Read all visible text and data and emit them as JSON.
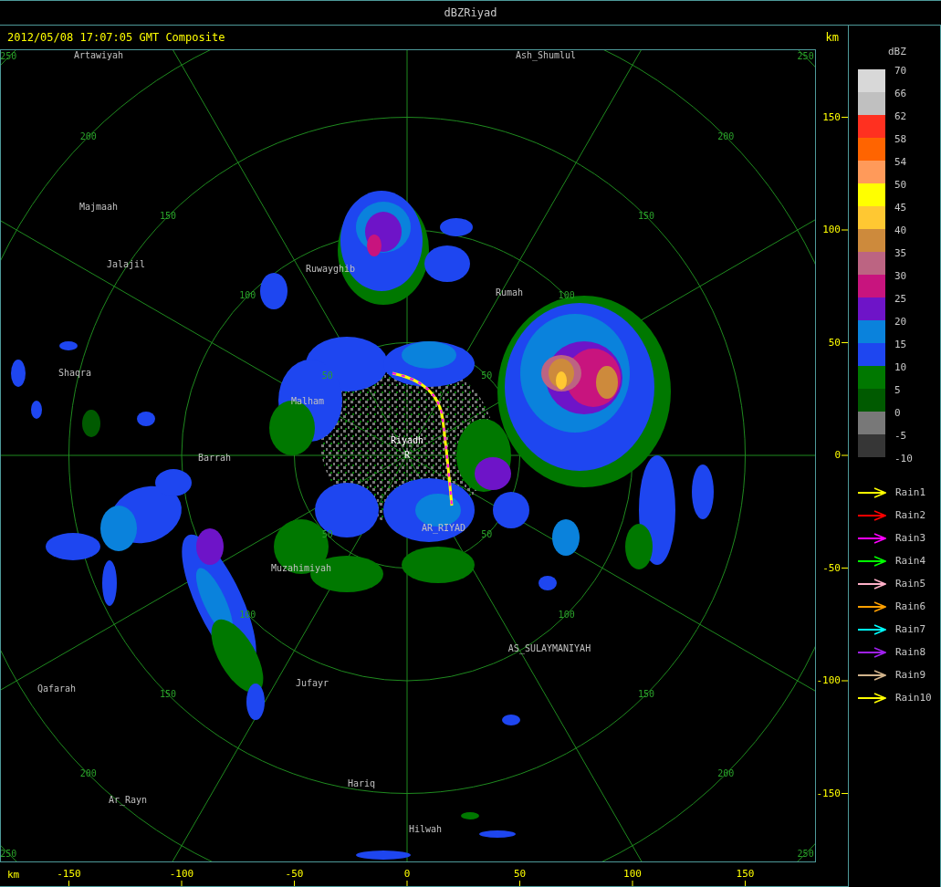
{
  "window": {
    "title": "dBZRiyad"
  },
  "header": {
    "timestamp": "2012/05/08 17:07:05 GMT Composite",
    "unit": "km"
  },
  "map": {
    "center_label": "R",
    "rings": [
      {
        "labels": [
          "250",
          "250",
          "250",
          "250"
        ]
      },
      {
        "labels": [
          "200",
          "200",
          "200",
          "200"
        ]
      },
      {
        "labels": [
          "150",
          "150",
          "150",
          "150"
        ]
      },
      {
        "labels": [
          "100",
          "100",
          "100",
          "100"
        ]
      },
      {
        "labels": [
          "50",
          "50",
          "50",
          "50"
        ]
      }
    ],
    "places": [
      {
        "name": "Artawiyah",
        "kind": "town"
      },
      {
        "name": "Ash_Shumlul",
        "kind": "town"
      },
      {
        "name": "Majmaah",
        "kind": "town"
      },
      {
        "name": "Jalajil",
        "kind": "town"
      },
      {
        "name": "Ruwayghib",
        "kind": "town"
      },
      {
        "name": "Rumah",
        "kind": "town"
      },
      {
        "name": "Shaqra",
        "kind": "town"
      },
      {
        "name": "Malham",
        "kind": "town"
      },
      {
        "name": "Riyadh",
        "kind": "radar"
      },
      {
        "name": "Barrah",
        "kind": "town"
      },
      {
        "name": "AR_RIYAD",
        "kind": "town"
      },
      {
        "name": "Muzahimiyah",
        "kind": "town"
      },
      {
        "name": "AS_SULAYMANIYAH",
        "kind": "town"
      },
      {
        "name": "Jufayr",
        "kind": "town"
      },
      {
        "name": "Qafarah",
        "kind": "town"
      },
      {
        "name": "Hariq",
        "kind": "town"
      },
      {
        "name": "Ar_Rayn",
        "kind": "town"
      },
      {
        "name": "Hilwah",
        "kind": "town"
      }
    ]
  },
  "x_axis": {
    "unit": "km",
    "ticks": [
      "-150",
      "-100",
      "-50",
      "0",
      "50",
      "100",
      "150"
    ]
  },
  "y_axis": {
    "ticks": [
      "150",
      "100",
      "50",
      "0",
      "-50",
      "-100",
      "-150"
    ]
  },
  "legend": {
    "unit": "dBZ",
    "labels": [
      "70",
      "66",
      "62",
      "58",
      "54",
      "50",
      "45",
      "40",
      "35",
      "30",
      "25",
      "20",
      "15",
      "10",
      "5",
      "0",
      "-5",
      "-10"
    ],
    "bins": [
      {
        "color": "#d8d8d8"
      },
      {
        "color": "#c0c0c0"
      },
      {
        "color": "#ff3020"
      },
      {
        "color": "#ff6400"
      },
      {
        "color": "#ff9a5a"
      },
      {
        "color": "#ffff00"
      },
      {
        "color": "#ffc832"
      },
      {
        "color": "#cd8a3c"
      },
      {
        "color": "#bc6482"
      },
      {
        "color": "#c8147e"
      },
      {
        "color": "#6e14c8"
      },
      {
        "color": "#0a82dc"
      },
      {
        "color": "#1e46f0"
      },
      {
        "color": "#007800"
      },
      {
        "color": "#005a00"
      },
      {
        "color": "#787878"
      },
      {
        "color": "#363636"
      }
    ],
    "tracks": [
      {
        "label": "Rain1",
        "color": "#ffff00"
      },
      {
        "label": "Rain2",
        "color": "#ff0000"
      },
      {
        "label": "Rain3",
        "color": "#ff00ff"
      },
      {
        "label": "Rain4",
        "color": "#00ff00"
      },
      {
        "label": "Rain5",
        "color": "#ffb0c8"
      },
      {
        "label": "Rain6",
        "color": "#ffa000"
      },
      {
        "label": "Rain7",
        "color": "#00ffff"
      },
      {
        "label": "Rain8",
        "color": "#a020f0"
      },
      {
        "label": "Rain9",
        "color": "#d2b48c"
      },
      {
        "label": "Rain10",
        "color": "#ffff00"
      }
    ]
  }
}
